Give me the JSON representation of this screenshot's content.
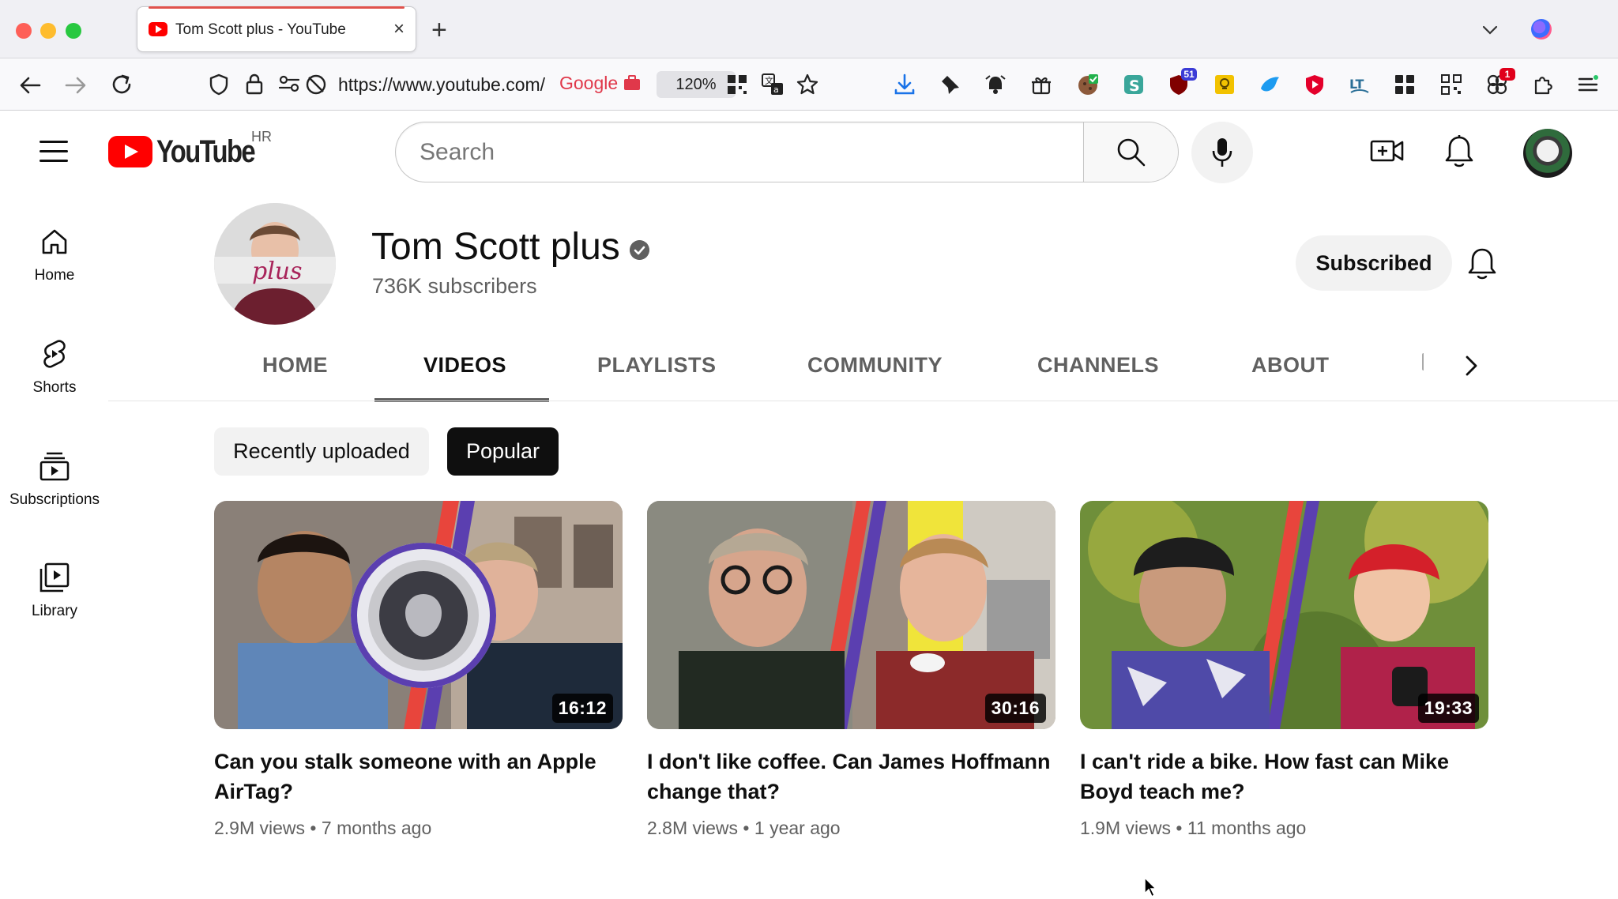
{
  "browser": {
    "tab_title": "Tom Scott plus - YouTube",
    "tab_close": "×",
    "new_tab": "+",
    "url": "https://www.youtube.com/",
    "google_badge": "Google",
    "zoom": "120%",
    "extension_badges": {
      "badge_51": "51",
      "badge_1": "1"
    },
    "accent_color": "#e0514c"
  },
  "youtube": {
    "logo_text": "YouTube",
    "region": "HR",
    "search_placeholder": "Search",
    "brand_color": "#ff0000"
  },
  "guide": {
    "items": [
      {
        "label": "Home",
        "icon": "home-icon"
      },
      {
        "label": "Shorts",
        "icon": "shorts-icon"
      },
      {
        "label": "Subscriptions",
        "icon": "subscriptions-icon"
      },
      {
        "label": "Library",
        "icon": "library-icon"
      }
    ]
  },
  "channel": {
    "name": "Tom Scott plus",
    "avatar_text": "plus",
    "subscribers": "736K subscribers",
    "subscribe_label": "Subscribed"
  },
  "tabs": [
    {
      "label": "HOME",
      "active": false
    },
    {
      "label": "VIDEOS",
      "active": true
    },
    {
      "label": "PLAYLISTS",
      "active": false
    },
    {
      "label": "COMMUNITY",
      "active": false
    },
    {
      "label": "CHANNELS",
      "active": false
    },
    {
      "label": "ABOUT",
      "active": false
    }
  ],
  "chips": [
    {
      "label": "Recently uploaded",
      "selected": false
    },
    {
      "label": "Popular",
      "selected": true
    }
  ],
  "videos": [
    {
      "title": "Can you stalk someone with an Apple AirTag?",
      "duration": "16:12",
      "views": "2.9M views",
      "age": "7 months ago"
    },
    {
      "title": "I don't like coffee. Can James Hoffmann change that?",
      "duration": "30:16",
      "views": "2.8M views",
      "age": "1 year ago"
    },
    {
      "title": "I can't ride a bike. How fast can Mike Boyd teach me?",
      "duration": "19:33",
      "views": "1.9M views",
      "age": "11 months ago"
    }
  ]
}
